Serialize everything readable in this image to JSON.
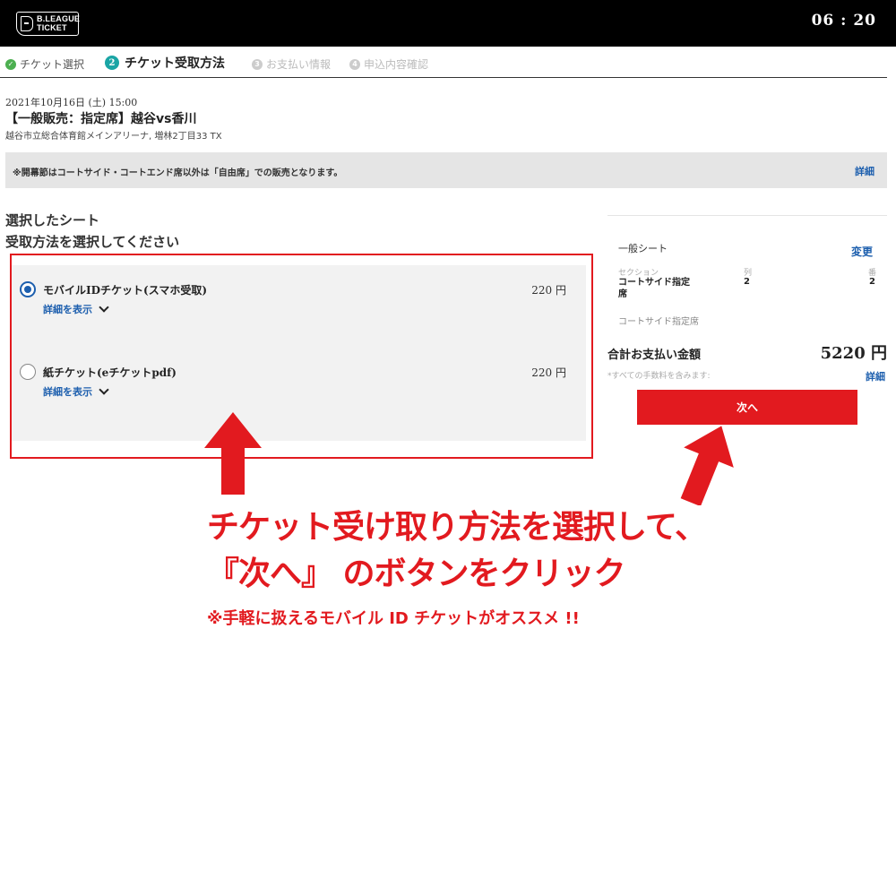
{
  "header": {
    "logo_line1": "B.LEAGUE",
    "logo_line2": "TICKET",
    "timer": "06 : 20"
  },
  "steps": [
    {
      "num": "✓",
      "label": "チケット選択"
    },
    {
      "num": "2",
      "label": "チケット受取方法"
    },
    {
      "num": "3",
      "label": "お支払い情報"
    },
    {
      "num": "4",
      "label": "申込内容確認"
    }
  ],
  "event": {
    "date": "2021年10月16日 (土) 15:00",
    "title": "【一般販売：指定席】越谷vs香川",
    "venue": "越谷市立総合体育館メインアリーナ, 増林2丁目33 TX"
  },
  "notice": {
    "text": "※開幕節はコートサイド・コートエンド席以外は「自由席」での販売となります。",
    "link": "詳細"
  },
  "section_heading": "選択したシート",
  "sub_heading": "受取方法を選択してください",
  "options": [
    {
      "name": "モバイルIDチケット(スマホ受取)",
      "price": "220 円",
      "detail": "詳細を表示",
      "selected": true
    },
    {
      "name": "紙チケット(eチケットpdf)",
      "price": "220 円",
      "detail": "詳細を表示",
      "selected": false
    }
  ],
  "summary": {
    "seat_type": "一般シート",
    "change": "変更",
    "labels": {
      "section": "セクション",
      "row": "列",
      "number": "番"
    },
    "values": {
      "section": "コートサイド指定席",
      "row": "2",
      "number": "2"
    },
    "seat_area": "コートサイド指定席",
    "total_label": "合計お支払い金額",
    "total_value": "5220 円",
    "fee_note": "*すべての手数料を含みます:",
    "fee_link": "詳細",
    "next_button": "次へ"
  },
  "annotation": {
    "line1": "チケット受け取り方法を選択して、",
    "line2": "『次へ』 のボタンをクリック",
    "note": "※手軽に扱えるモバイル ID チケットがオススメ !!"
  },
  "colors": {
    "accent_red": "#e21a1f",
    "link_blue": "#1d5fae",
    "step_teal": "#1aa5a5",
    "done_green": "#4caf50"
  }
}
